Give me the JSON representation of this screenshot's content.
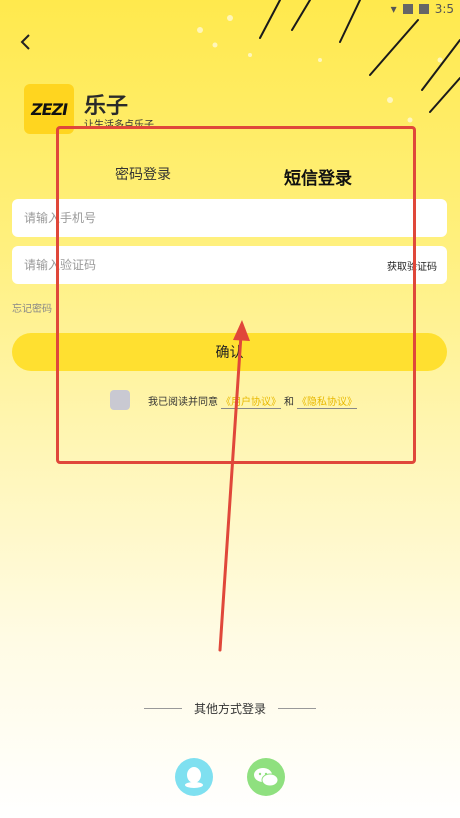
{
  "status": {
    "time": "3:5"
  },
  "app": {
    "logo_text": "ZEZI",
    "name": "乐子",
    "slogan": "让生活多点乐子"
  },
  "tabs": [
    {
      "label": "密码登录",
      "active": false
    },
    {
      "label": "短信登录",
      "active": true
    }
  ],
  "form": {
    "phone_placeholder": "请输入手机号",
    "phone_value": "",
    "code_placeholder": "请输入验证码",
    "code_value": "",
    "get_code_label": "获取验证码",
    "forgot_label": "忘记密码",
    "confirm_label": "确认"
  },
  "agreement": {
    "prefix": "我已阅读并同意",
    "user_agreement": "《用户协议》",
    "and": "和",
    "privacy": "《隐私协议》",
    "checked": false
  },
  "other": {
    "label": "其他方式登录",
    "qq_icon": "qq-icon",
    "wechat_icon": "wechat-icon"
  },
  "colors": {
    "accent": "#ffe030",
    "annotation": "#e0473a",
    "link": "#e8b800"
  }
}
